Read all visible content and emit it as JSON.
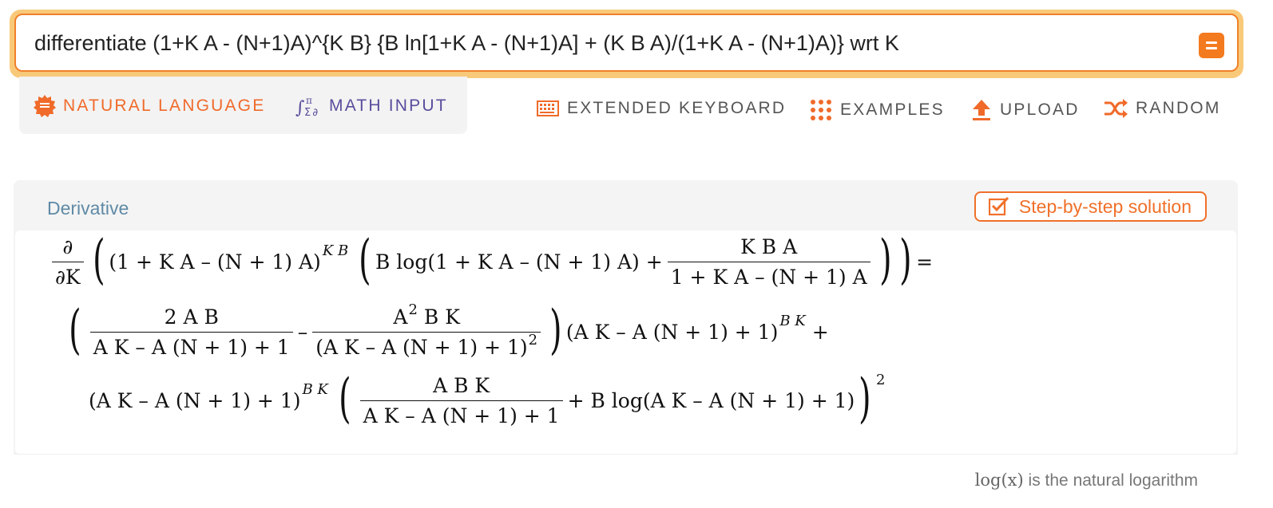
{
  "search": {
    "query": "differentiate (1+K A - (N+1)A)^{K B} {B ln[1+K A - (N+1)A] + (K B A)/(1+K A - (N+1)A)} wrt K"
  },
  "modes": {
    "natural_language": "NATURAL LANGUAGE",
    "math_input": "MATH INPUT"
  },
  "toolbar": {
    "extended_keyboard": "EXTENDED KEYBOARD",
    "examples": "EXAMPLES",
    "upload": "UPLOAD",
    "random": "RANDOM"
  },
  "pod": {
    "title": "Derivative",
    "step_button": "Step-by-step solution",
    "note_fn": "log(x)",
    "note_text": "is the natural logarithm"
  },
  "math": {
    "d_num": "∂",
    "d_den": "∂K",
    "base_expr": "(1 + K A – (N + 1) A)",
    "exp_kb": "K B",
    "b_log": "B log(1 + K A – (N + 1) A) +",
    "frac1_num": "K B A",
    "frac1_den": "1 + K A – (N + 1) A",
    "equals": "=",
    "r2_f1_num": "2 A B",
    "r2_f1_den": "A K – A (N + 1) + 1",
    "minus": "–",
    "r2_f2_num": "A",
    "r2_f2_num_sup": "2",
    "r2_f2_num_rest": "B K",
    "r2_f2_den": "(A K – A (N + 1) + 1)",
    "r2_f2_den_sup": "2",
    "r2_base": "(A K – A (N + 1) + 1)",
    "exp_bk": "B K",
    "plus": "+",
    "r3_base": "(A K – A (N + 1) + 1)",
    "r3_f_num": "A B K",
    "r3_f_den": "A K – A (N + 1) + 1",
    "r3_tail": "+ B log(A K – A (N + 1) + 1)",
    "sq": "2"
  },
  "colors": {
    "accent_orange": "#f06a2a",
    "math_input_purple": "#5a4c9c",
    "pod_title_blue": "#5f8aa6",
    "search_glow": "#f9c97a"
  }
}
